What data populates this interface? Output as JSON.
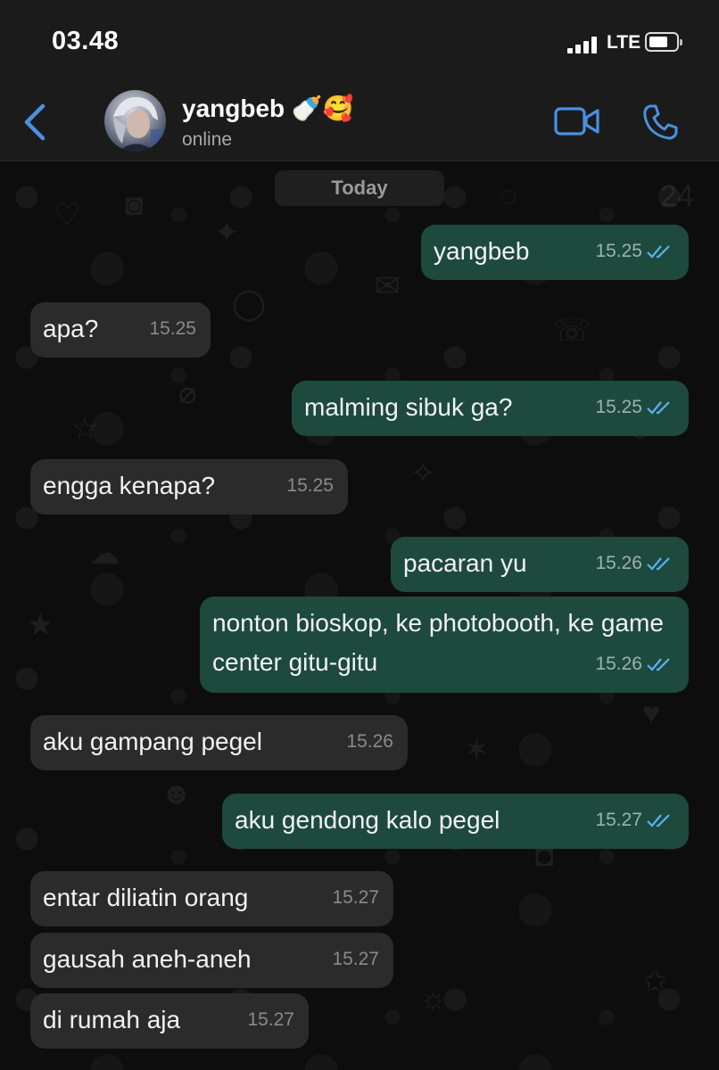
{
  "status_bar": {
    "time": "03.48",
    "network": "LTE"
  },
  "header": {
    "contact_name": "yangbeb 🍼🥰",
    "contact_status": "online"
  },
  "chat": {
    "date_label": "Today",
    "messages": [
      {
        "text": "yangbeb",
        "time": "15.25",
        "direction": "out"
      },
      {
        "text": "apa?",
        "time": "15.25",
        "direction": "in"
      },
      {
        "text": "malming sibuk ga?",
        "time": "15.25",
        "direction": "out"
      },
      {
        "text": "engga kenapa?",
        "time": "15.25",
        "direction": "in"
      },
      {
        "text": "pacaran yu",
        "time": "15.26",
        "direction": "out"
      },
      {
        "text": "nonton bioskop, ke photobooth, ke game center gitu-gitu",
        "time": "15.26",
        "direction": "out"
      },
      {
        "text": "aku gampang pegel",
        "time": "15.26",
        "direction": "in"
      },
      {
        "text": "aku gendong kalo pegel",
        "time": "15.27",
        "direction": "out"
      },
      {
        "text": "entar diliatin orang",
        "time": "15.27",
        "direction": "in"
      },
      {
        "text": "gausah aneh-aneh",
        "time": "15.27",
        "direction": "in"
      },
      {
        "text": "di rumah aja",
        "time": "15.27",
        "direction": "in"
      }
    ]
  },
  "colors": {
    "accent": "#4a90e2",
    "outgoing_bubble": "#1d4a3d",
    "incoming_bubble": "#2b2b2b",
    "read_ticks": "#5ab1f0"
  },
  "icons": {
    "back": "chevron-left-icon",
    "video": "video-camera-icon",
    "phone": "phone-icon"
  }
}
